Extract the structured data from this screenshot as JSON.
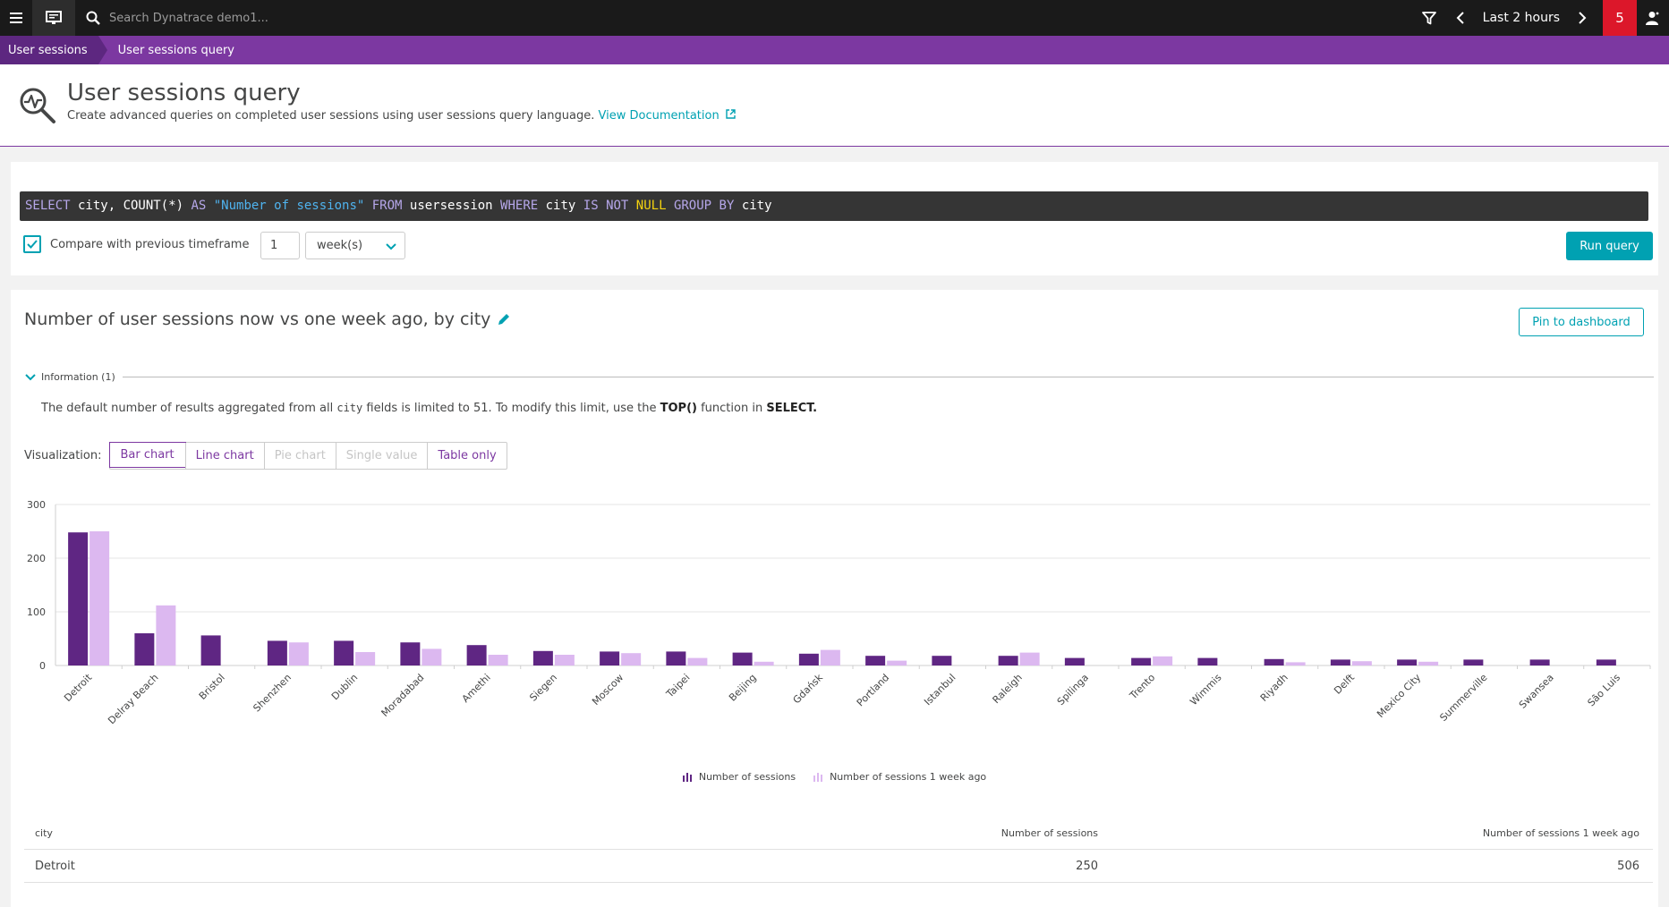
{
  "topbar": {
    "search_placeholder": "Search Dynatrace demo1...",
    "timeframe": "Last 2 hours",
    "problems_count": "5"
  },
  "breadcrumb": [
    "User sessions",
    "User sessions query"
  ],
  "header": {
    "title": "User sessions query",
    "description": "Create advanced queries on completed user sessions using user sessions query language.",
    "doc_link": "View Documentation"
  },
  "query": {
    "compare_label": "Compare with previous timeframe",
    "compare_checked": true,
    "compare_count": "1",
    "compare_unit": "week(s)",
    "run_label": "Run query"
  },
  "result": {
    "title": "Number of user sessions now vs one week ago, by city",
    "pin_label": "Pin to dashboard",
    "info_label": "Information (1)",
    "info_text_pre": "The default number of results aggregated from all ",
    "info_text_code": "city",
    "info_text_mid": " fields is limited to 51. To modify this limit, use the ",
    "info_text_fn": "TOP()",
    "info_text_mid2": " function in ",
    "info_text_kw": "SELECT.",
    "viz_label": "Visualization:",
    "viz_tabs": [
      "Bar chart",
      "Line chart",
      "Pie chart",
      "Single value",
      "Table only"
    ]
  },
  "chart_data": {
    "type": "bar",
    "categories": [
      "Detroit",
      "Delray Beach",
      "Bristol",
      "Shenzhen",
      "Dublin",
      "Moradabad",
      "Amethi",
      "Siegen",
      "Moscow",
      "Taipei",
      "Beijing",
      "Gdańsk",
      "Portland",
      "Istanbul",
      "Raleigh",
      "Spilinga",
      "Trento",
      "Wimmis",
      "Riyadh",
      "Delft",
      "Mexico City",
      "Summerville",
      "Swansea",
      "São Luis"
    ],
    "series": [
      {
        "name": "Number of sessions",
        "color": "#5f2683",
        "values": [
          248,
          60,
          56,
          46,
          46,
          43,
          38,
          27,
          26,
          26,
          24,
          22,
          18,
          18,
          18,
          14,
          14,
          14,
          12,
          11,
          11,
          11,
          11,
          11
        ]
      },
      {
        "name": "Number of sessions 1 week ago",
        "color": "#dcb8f0",
        "values": [
          250,
          112,
          0,
          43,
          25,
          31,
          20,
          20,
          23,
          14,
          7,
          29,
          9,
          0,
          24,
          0,
          17,
          0,
          6,
          8,
          7,
          0,
          0,
          0
        ]
      }
    ],
    "yticks": [
      "0",
      "100",
      "200",
      "300"
    ],
    "ylim": [
      0,
      300
    ]
  },
  "table": {
    "headers": [
      "city",
      "Number of sessions",
      "Number of sessions 1 week ago"
    ],
    "rows": [
      [
        "Detroit",
        "250",
        "506"
      ]
    ]
  }
}
